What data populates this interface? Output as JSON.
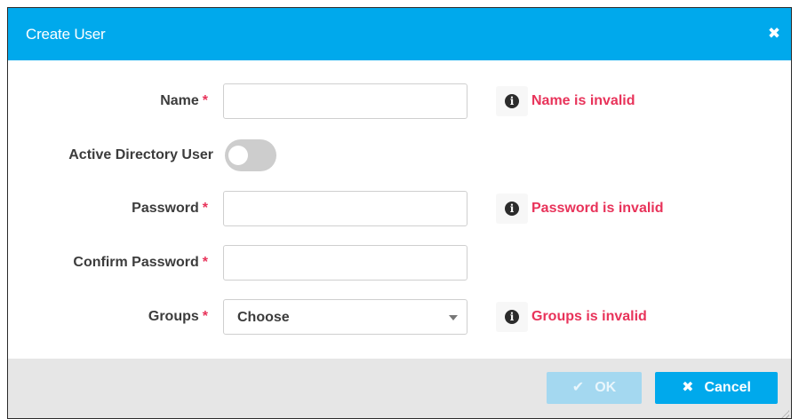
{
  "dialog": {
    "title": "Create User",
    "close_icon": "close-icon",
    "close_glyph": "✖"
  },
  "form": {
    "name": {
      "label": "Name",
      "required_marker": "*",
      "value": "",
      "error": "Name is invalid"
    },
    "active_directory": {
      "label": "Active Directory User",
      "toggled_on": false
    },
    "password": {
      "label": "Password",
      "required_marker": "*",
      "value": "",
      "error": "Password is invalid"
    },
    "confirm_password": {
      "label": "Confirm Password",
      "required_marker": "*",
      "value": ""
    },
    "groups": {
      "label": "Groups",
      "required_marker": "*",
      "selected": "Choose",
      "error": "Groups is invalid"
    },
    "error_icon": "info-icon",
    "error_icon_glyph": "i"
  },
  "footer": {
    "ok_label": "OK",
    "ok_icon": "check-icon",
    "ok_glyph": "✔",
    "ok_enabled": false,
    "cancel_label": "Cancel",
    "cancel_icon": "close-icon",
    "cancel_glyph": "✖"
  },
  "colors": {
    "header": "#00a9ec",
    "error": "#e8335a",
    "primary_button": "#00a9ec",
    "disabled_button": "#a4d8f0",
    "footer_bg": "#e6e6e6"
  }
}
